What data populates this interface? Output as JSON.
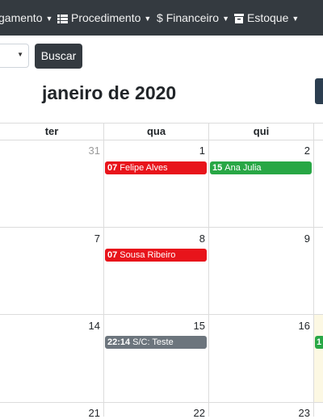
{
  "nav": {
    "agendamento_label": "gamento",
    "procedimento_label": "Procedimento",
    "financeiro_label": "Financeiro",
    "financeiro_symbol": "$",
    "estoque_label": "Estoque"
  },
  "search": {
    "button_label": "Buscar",
    "select_value": ""
  },
  "calendar": {
    "title": "janeiro de 2020",
    "weekdays": [
      "ter",
      "qua",
      "qui"
    ],
    "weeks": [
      {
        "days": [
          "31",
          "1",
          "2"
        ]
      },
      {
        "days": [
          "7",
          "8",
          "9"
        ]
      },
      {
        "days": [
          "14",
          "15",
          "16"
        ]
      },
      {
        "days": [
          "21",
          "22",
          "23"
        ]
      }
    ],
    "events": [
      {
        "time": "07",
        "title": "Felipe Alves",
        "color": "#e8141b"
      },
      {
        "time": "15",
        "title": "Ana Julia",
        "color": "#28a745"
      },
      {
        "time": "07",
        "title": "Sousa Ribeiro",
        "color": "#e8141b"
      },
      {
        "time": "22:14",
        "title": "S/C: Teste",
        "color": "#6c757d"
      },
      {
        "time": "1",
        "title": "",
        "color": "#28a745"
      }
    ],
    "today_color": "#fcf8e3"
  }
}
